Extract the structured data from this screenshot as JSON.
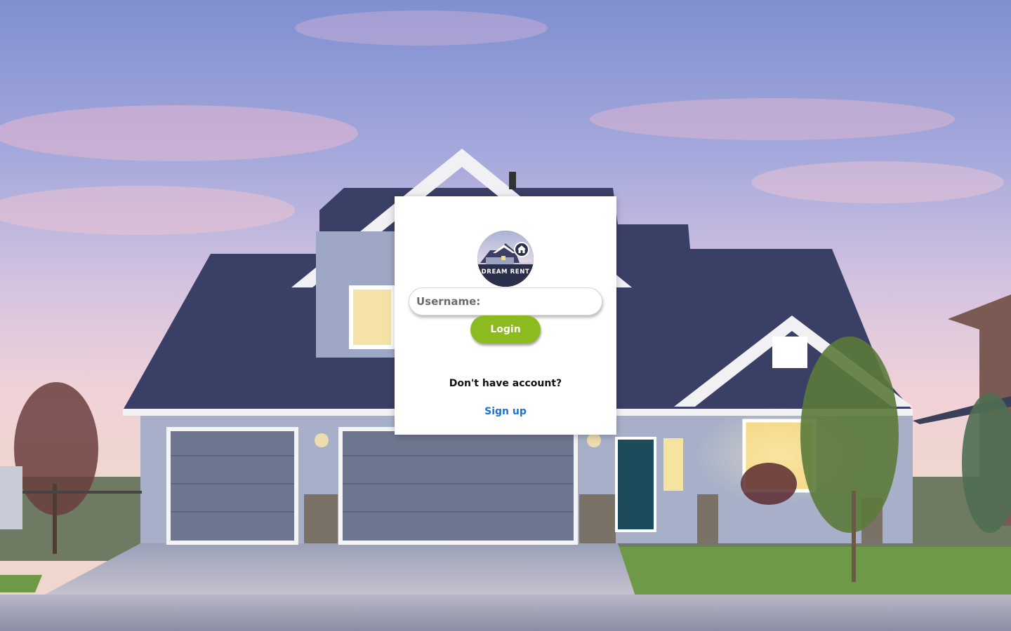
{
  "logo": {
    "text": "DREAM RENT",
    "icon": "house-icon"
  },
  "login_form": {
    "username_placeholder": "Username:",
    "username_value": "",
    "login_label": "Login",
    "no_account_text": "Don't have account?",
    "signup_label": "Sign up"
  },
  "colors": {
    "login_button": "#8cbb1f",
    "signup_link": "#1a73d9",
    "card_background": "#ffffff"
  }
}
